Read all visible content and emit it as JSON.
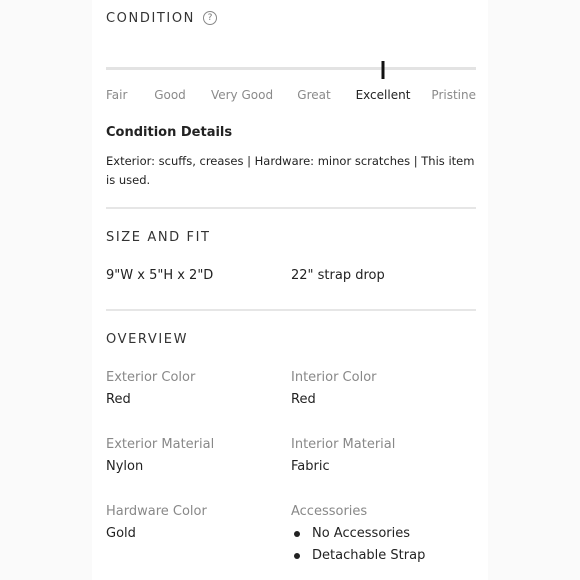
{
  "condition": {
    "title": "CONDITION",
    "help_icon": "question-circle-icon",
    "scale": [
      "Fair",
      "Good",
      "Very Good",
      "Great",
      "Excellent",
      "Pristine"
    ],
    "selected": "Excellent",
    "details_title": "Condition Details",
    "details_text": "Exterior: scuffs, creases | Hardware: minor scratches | This item is used."
  },
  "size_fit": {
    "title": "SIZE AND FIT",
    "dimensions": "9\"W x 5\"H x 2\"D",
    "strap_drop": "22\" strap drop"
  },
  "overview": {
    "title": "OVERVIEW",
    "exterior_color": {
      "label": "Exterior Color",
      "value": "Red"
    },
    "interior_color": {
      "label": "Interior Color",
      "value": "Red"
    },
    "exterior_material": {
      "label": "Exterior Material",
      "value": "Nylon"
    },
    "interior_material": {
      "label": "Interior Material",
      "value": "Fabric"
    },
    "hardware_color": {
      "label": "Hardware Color",
      "value": "Gold"
    },
    "accessories": {
      "label": "Accessories",
      "items": [
        "No Accessories",
        "Detachable Strap"
      ]
    }
  }
}
